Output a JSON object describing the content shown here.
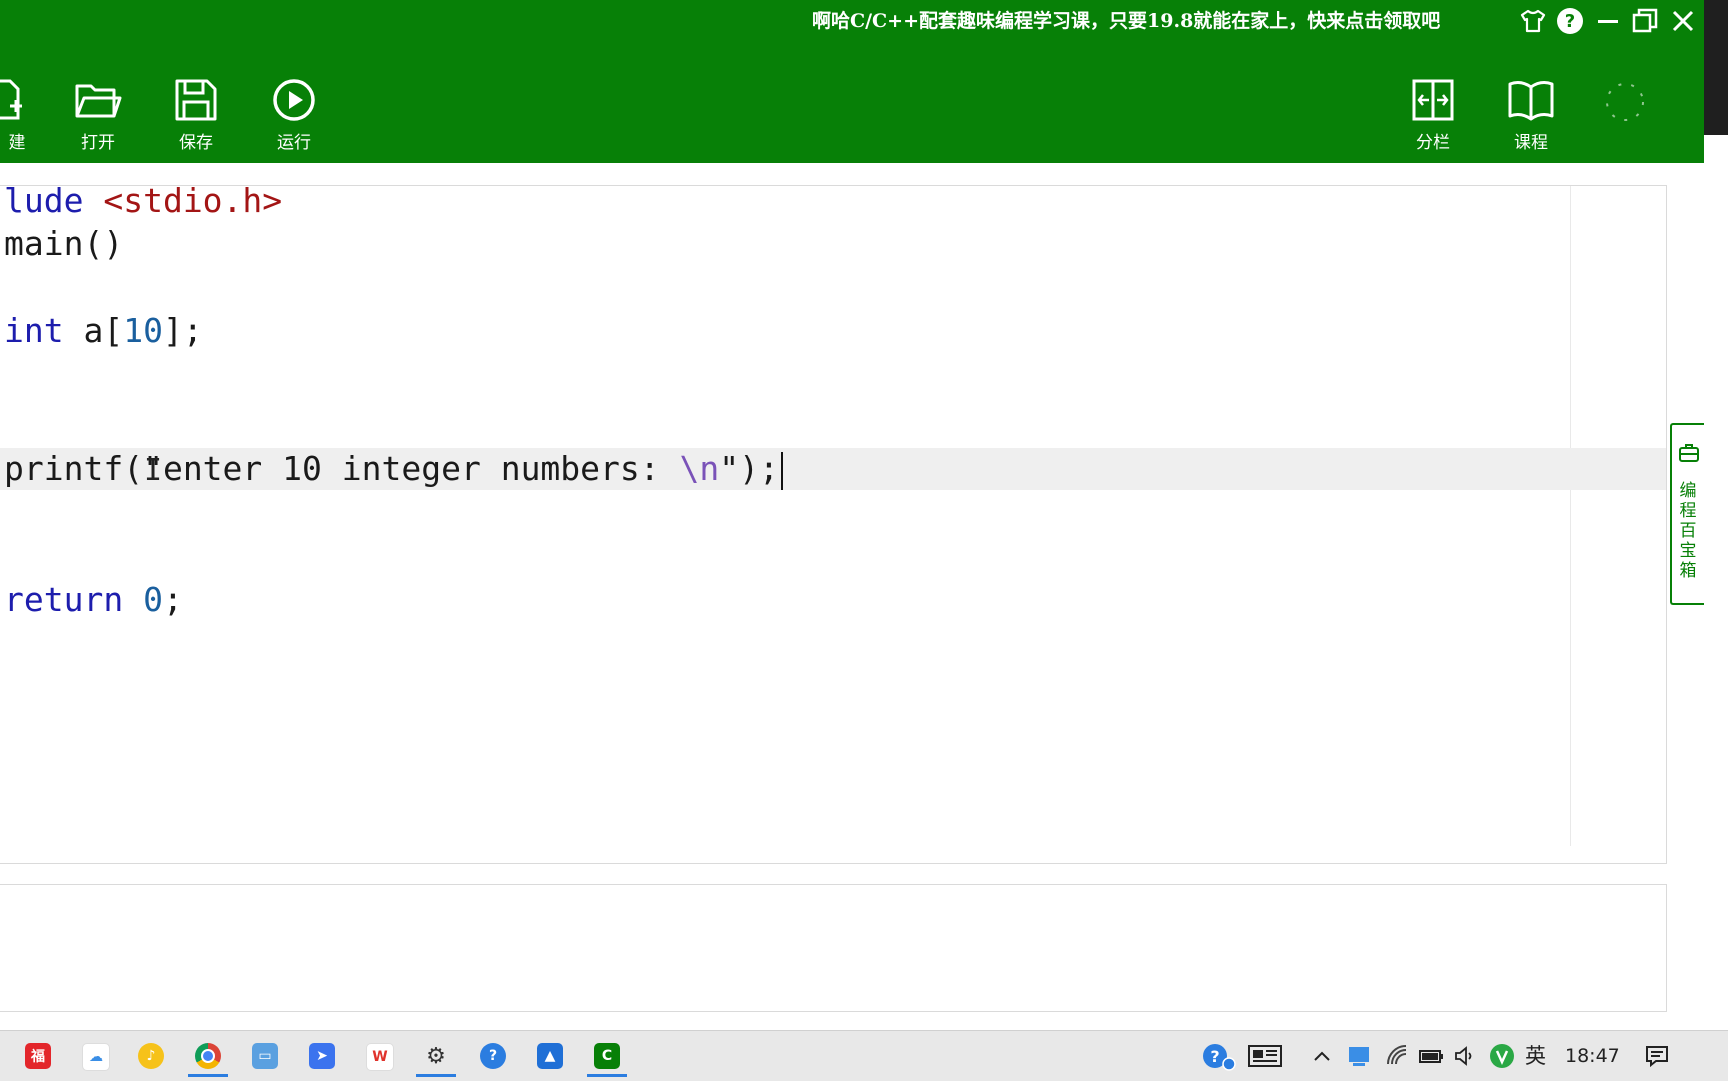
{
  "promo_text": "啊哈C/C++配套趣味编程学习课，只要19.8就能在家上，快来点击领取吧",
  "window_controls": {
    "skin_icon": "shirt-icon",
    "help_icon": "help-icon",
    "minimize_icon": "minimize-icon",
    "restore_icon": "restore-icon",
    "close_icon": "close-icon"
  },
  "toolbar": {
    "new_label": "建",
    "open_label": "打开",
    "save_label": "保存",
    "run_label": "运行",
    "split_label": "分栏",
    "course_label": "课程"
  },
  "code_lines": {
    "l1_kw": "lude ",
    "l1_str": "<stdio.h>",
    "l2": "main()",
    "l4_kw": "int",
    "l4_a": " a[",
    "l4_num": "10",
    "l4_b": "];",
    "l7_a": "printf(",
    "l7_str": "\"enter 10 integer numbers: ",
    "l7_esc": "\\n",
    "l7_end": "\");",
    "l10_kw": "return",
    "l10_sp": " ",
    "l10_num": "0",
    "l10_end": ";"
  },
  "side_panel": {
    "label": "编程百宝箱",
    "icon": "toolbox-icon"
  },
  "taskbar": {
    "apps": [
      "pdf-reader-icon",
      "cloud-drive-icon",
      "qq-music-icon",
      "chrome-icon",
      "explorer-icon",
      "feishu-icon",
      "wps-icon",
      "settings-icon",
      "help-app-icon",
      "photos-icon",
      "aha-c-icon"
    ],
    "ime": "英",
    "clock": "18:47"
  }
}
